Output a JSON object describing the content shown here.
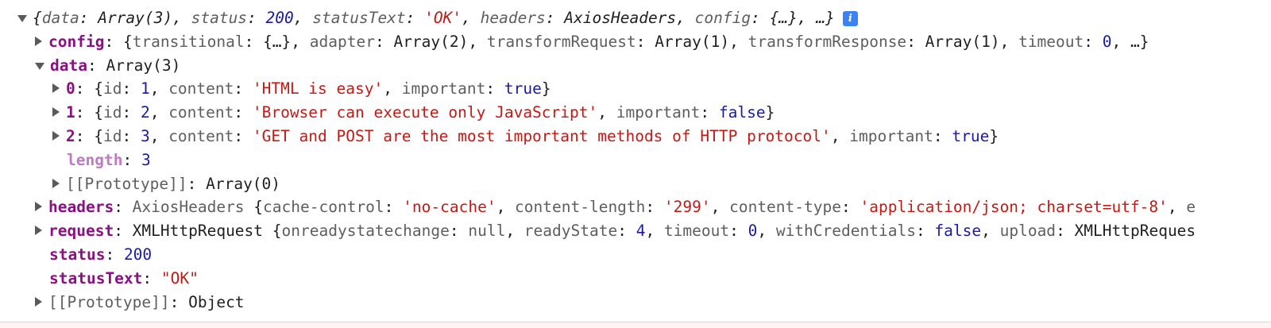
{
  "summary": {
    "open": "{",
    "data_key": "data",
    "data_val": "Array(3)",
    "status_key": "status",
    "status_val": "200",
    "statusText_key": "statusText",
    "statusText_val": "'OK'",
    "headers_key": "headers",
    "headers_val": "AxiosHeaders",
    "config_key": "config",
    "config_val": "{…}",
    "tail": "…}",
    "info_icon": "i"
  },
  "config": {
    "key": "config",
    "open": "{",
    "transitional_key": "transitional",
    "transitional_val": "{…}",
    "adapter_key": "adapter",
    "adapter_val": "Array(2)",
    "transformRequest_key": "transformRequest",
    "transformRequest_val": "Array(1)",
    "transformResponse_key": "transformResponse",
    "transformResponse_val": "Array(1)",
    "timeout_key": "timeout",
    "timeout_val": "0",
    "tail": "…}"
  },
  "data": {
    "key": "data",
    "value": "Array(3)",
    "items": [
      {
        "index": "0",
        "id": "1",
        "content": "'HTML is easy'",
        "important": "true"
      },
      {
        "index": "1",
        "id": "2",
        "content": "'Browser can execute only JavaScript'",
        "important": "false"
      },
      {
        "index": "2",
        "id": "3",
        "content": "'GET and POST are the most important methods of HTTP protocol'",
        "important": "true"
      }
    ],
    "id_key": "id",
    "content_key": "content",
    "important_key": "important",
    "length_key": "length",
    "length_val": "3",
    "proto_key": "[[Prototype]]",
    "proto_val": "Array(0)"
  },
  "headers": {
    "key": "headers",
    "type": "AxiosHeaders",
    "cache_key": "cache-control",
    "cache_val": "'no-cache'",
    "length_key": "content-length",
    "length_val": "'299'",
    "ctype_key": "content-type",
    "ctype_val": "'application/json; charset=utf-8'",
    "cut": "e"
  },
  "request": {
    "key": "request",
    "type": "XMLHttpRequest",
    "orsc_key": "onreadystatechange",
    "orsc_val": "null",
    "rs_key": "readyState",
    "rs_val": "4",
    "timeout_key": "timeout",
    "timeout_val": "0",
    "wc_key": "withCredentials",
    "wc_val": "false",
    "upload_key": "upload",
    "upload_val": "XMLHttpReques"
  },
  "status": {
    "key": "status",
    "value": "200"
  },
  "statusText": {
    "key": "statusText",
    "value": "\"OK\""
  },
  "proto": {
    "key": "[[Prototype]]",
    "value": "Object"
  }
}
